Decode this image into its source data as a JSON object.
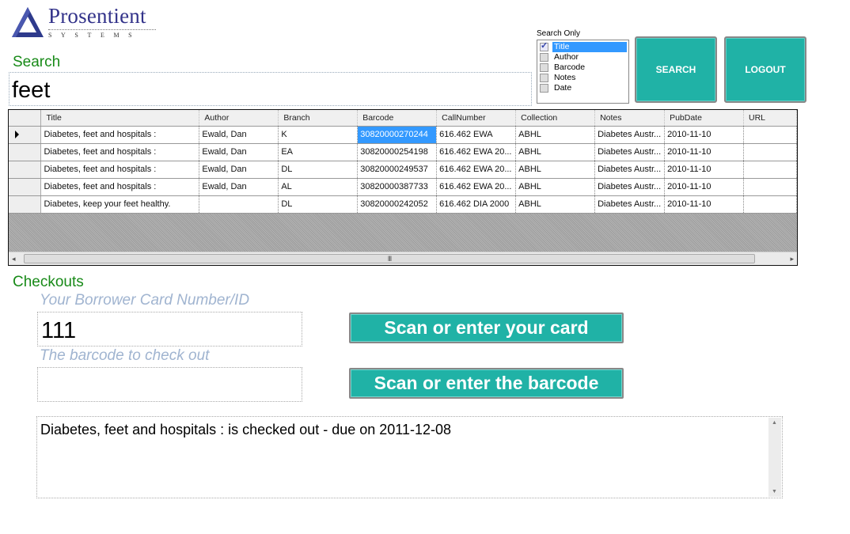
{
  "logo": {
    "brand": "Prosentient",
    "subtitle": "SYSTEMS"
  },
  "search": {
    "label": "Search",
    "query": "feet",
    "search_only_caption": "Search Only",
    "fields": [
      {
        "label": "Title",
        "checked": true,
        "selected": true
      },
      {
        "label": "Author",
        "checked": false,
        "selected": false
      },
      {
        "label": "Barcode",
        "checked": false,
        "selected": false
      },
      {
        "label": "Notes",
        "checked": false,
        "selected": false
      },
      {
        "label": "Date",
        "checked": false,
        "selected": false
      }
    ],
    "search_button": "SEARCH",
    "logout_button": "LOGOUT"
  },
  "results": {
    "columns": [
      "Title",
      "Author",
      "Branch",
      "Barcode",
      "CallNumber",
      "Collection",
      "Notes",
      "PubDate",
      "URL"
    ],
    "current_row": 0,
    "selected_cell": {
      "row": 0,
      "column": "Barcode"
    },
    "rows": [
      [
        "Diabetes, feet and hospitals :",
        "Ewald, Dan",
        "K",
        "30820000270244",
        "616.462 EWA",
        "ABHL",
        "Diabetes Austr...",
        "2010-11-10",
        ""
      ],
      [
        "Diabetes, feet and hospitals :",
        "Ewald, Dan",
        "EA",
        "30820000254198",
        "616.462 EWA 20...",
        "ABHL",
        "Diabetes Austr...",
        "2010-11-10",
        ""
      ],
      [
        "Diabetes, feet and hospitals :",
        "Ewald, Dan",
        "DL",
        "30820000249537",
        "616.462 EWA 20...",
        "ABHL",
        "Diabetes Austr...",
        "2010-11-10",
        ""
      ],
      [
        "Diabetes, feet and hospitals :",
        "Ewald, Dan",
        "AL",
        "30820000387733",
        "616.462 EWA 20...",
        "ABHL",
        "Diabetes Austr...",
        "2010-11-10",
        ""
      ],
      [
        "Diabetes, keep your feet healthy.",
        "",
        "DL",
        "30820000242052",
        "616.462 DIA 2000",
        "ABHL",
        "Diabetes Austr...",
        "2010-11-10",
        ""
      ]
    ],
    "scroll_grip": "III"
  },
  "checkouts": {
    "label": "Checkouts",
    "card_hint": "Your Borrower Card Number/ID",
    "card_value": "111",
    "barcode_hint": "The barcode to check out",
    "barcode_value": "",
    "scan_card_button": "Scan or enter your card",
    "scan_barcode_button": "Scan or enter the barcode",
    "message": "Diabetes, feet and hospitals : is checked out - due on 2011-12-08"
  },
  "colors": {
    "accent": "#20b2a6",
    "section_label": "#188a18",
    "hint": "#a0b4d0",
    "selection": "#3399ff",
    "brand": "#33338a"
  }
}
